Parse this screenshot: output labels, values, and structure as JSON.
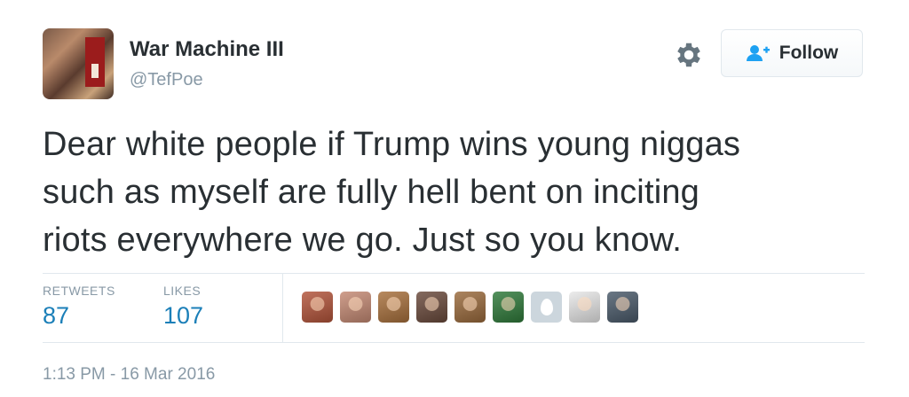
{
  "tweet": {
    "author": {
      "display_name": "War Machine III",
      "handle": "@TefPoe",
      "avatar_icon": "profile-avatar"
    },
    "actions": {
      "settings_icon": "gear-icon",
      "follow_icon": "add-user-icon",
      "follow_label": "Follow"
    },
    "text_lines": [
      "Dear white people if Trump wins young niggas",
      "such as myself are fully hell bent on inciting",
      "riots everywhere we go. Just so you know."
    ],
    "stats": {
      "retweets_label": "RETWEETS",
      "retweets_count": "87",
      "likes_label": "LIKES",
      "likes_count": "107"
    },
    "likers": [
      {
        "icon": "liker-avatar",
        "color": "#b3543a"
      },
      {
        "icon": "liker-avatar",
        "color": "#c58a74"
      },
      {
        "icon": "liker-avatar",
        "color": "#a8703c"
      },
      {
        "icon": "liker-avatar",
        "color": "#6a4a3c"
      },
      {
        "icon": "liker-avatar",
        "color": "#9a6a3c"
      },
      {
        "icon": "liker-avatar",
        "color": "#2f7a3a"
      },
      {
        "icon": "default-egg-avatar",
        "color": "#ccd6dd"
      },
      {
        "icon": "liker-avatar",
        "color": "#e8e8e8"
      },
      {
        "icon": "liker-avatar",
        "color": "#4a5a6a"
      }
    ],
    "timestamp": "1:13 PM - 16 Mar 2016"
  },
  "colors": {
    "link_blue": "#1b7fb8",
    "muted_gray": "#8899a6",
    "text": "#292f33",
    "border": "#e1e8ed"
  }
}
